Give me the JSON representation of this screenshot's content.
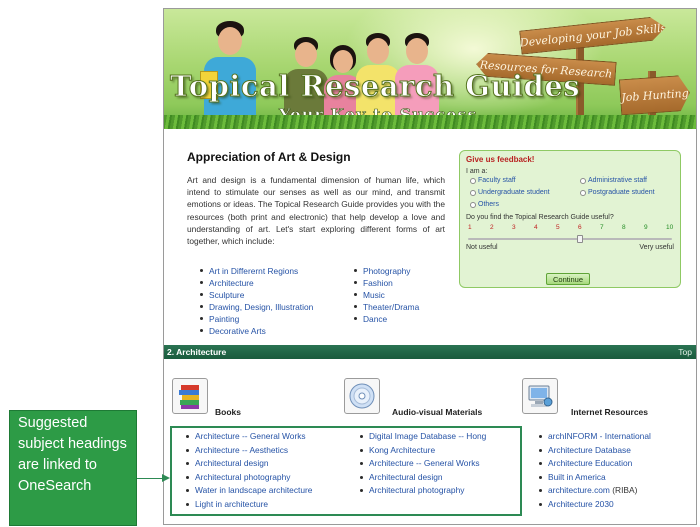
{
  "banner": {
    "title": "Topical Research Guides",
    "subtitle": "Your Key to Success",
    "signs": [
      "Developing your Job Skills",
      "Resources for Research",
      "Job Hunting"
    ]
  },
  "intro": {
    "title": "Appreciation of Art & Design",
    "text": "Art and design is a fundamental dimension of human life, which intend to stimulate our senses as well as our mind, and transmit emotions or ideas. The Topical Research Guide provides you with the resources (both print and electronic) that help develop a love and understanding of art. Let's start exploring different forms of art together, which include:",
    "list_left": [
      "Art in Differernt Regions",
      "Architecture",
      "Sculpture",
      "Drawing, Design, Illustration",
      "Painting",
      "Decorative Arts"
    ],
    "list_right": [
      "Photography",
      "Fashion",
      "Music",
      "Theater/Drama",
      "Dance"
    ]
  },
  "feedback": {
    "title": "Give us feedback!",
    "i_am": "I am a:",
    "options": [
      "Faculty staff",
      "Administrative staff",
      "Undergraduate student",
      "Postgraduate student",
      "Others"
    ],
    "question": "Do you find the Topical Research Guide useful?",
    "scale": [
      "1",
      "2",
      "3",
      "4",
      "5",
      "6",
      "7",
      "8",
      "9",
      "10"
    ],
    "selected_value": 6,
    "low_label": "Not useful",
    "high_label": "Very useful",
    "button": "Continue"
  },
  "section": {
    "heading": "2. Architecture",
    "top_link": "Top"
  },
  "books": {
    "title": "Books",
    "items": [
      "Architecture -- General Works",
      "Architecture -- Aesthetics",
      "Architectural design",
      "Architectural photography",
      "Water in landscape architecture",
      "Light in architecture"
    ]
  },
  "av": {
    "title": "Audio-visual Materials",
    "items": [
      "Digital Image Database -- Hong",
      "Kong Architecture",
      "Architecture -- General Works",
      "Architectural design",
      "Architectural photography"
    ]
  },
  "internet": {
    "title": "Internet Resources",
    "items": [
      "archINFORM - International",
      "Architecture Database",
      "Architecture Education",
      "Built in America",
      "architecture.com",
      "Architecture 2030"
    ],
    "suffix": "(RIBA)"
  },
  "callout": {
    "text": "Suggested subject headings are linked to OneSearch"
  },
  "colors": {
    "section_header": "#1a5b3d",
    "callout": "#2d9b46",
    "link": "#2653a6",
    "feedback_title": "#b82222"
  }
}
